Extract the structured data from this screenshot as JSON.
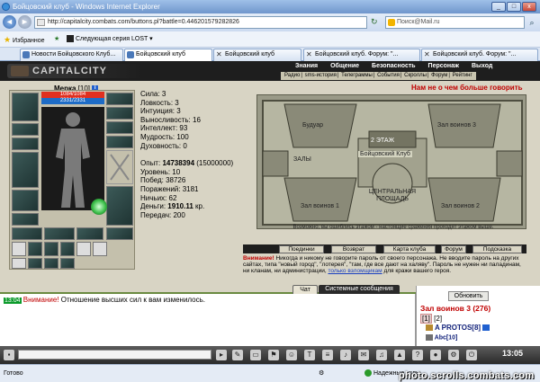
{
  "window": {
    "title": "Бойцовский клуб - Windows Internet Explorer",
    "min": "_",
    "max": "□",
    "close": "x"
  },
  "address": {
    "back": "◄",
    "forward": "►",
    "url": "http://capitalcity.combats.com/buttons.pl?battle=0.446201579282826",
    "search_placeholder": "Поиск@Mail.ru",
    "search_go": "⌕"
  },
  "favbar": {
    "favorites_label": "Избранное",
    "item": "Следующая серия LOST"
  },
  "tabs": [
    {
      "label": "Новости Бойцовского Клуб...",
      "active": false
    },
    {
      "label": "Бойцовский клуб",
      "active": true
    },
    {
      "label": "Бойцовский клуб",
      "active": false
    },
    {
      "label": "Бойцовский клуб. Форум: \"...",
      "active": false
    },
    {
      "label": "Бойцовский клуб. Форум: \"...",
      "active": false
    }
  ],
  "game": {
    "logo": "CAPITALCITY",
    "menu": [
      "Знания",
      "Общение",
      "Безопасность",
      "Персонаж",
      "Выход"
    ],
    "submenu": [
      "Радио",
      "sms-история",
      "Телеграммы",
      "События",
      "Скроллы",
      "Форум",
      "Рейтинг"
    ]
  },
  "character": {
    "name": "Мерка",
    "level": "[10]",
    "hp": "1084/1084",
    "mana": "2331/2331"
  },
  "stats": [
    {
      "label": "Сила:",
      "value": "3"
    },
    {
      "label": "Ловкость:",
      "value": "3"
    },
    {
      "label": "Интуиция:",
      "value": "3"
    },
    {
      "label": "Выносливость:",
      "value": "16"
    },
    {
      "label": "Интеллект:",
      "value": "93"
    },
    {
      "label": "Мудрость:",
      "value": "100"
    },
    {
      "label": "Духовность:",
      "value": "0"
    }
  ],
  "stats2": {
    "exp_label": "Опыт:",
    "exp_value": "14738394",
    "exp_next": "(15000000)",
    "level_line": "Уровень: 10",
    "wins_line": "Побед: 38726",
    "losses_line": "Поражений: 3181",
    "draws_line": "Ничьих: 62",
    "money_label": "Деньги:",
    "money_value": "1910.11",
    "money_unit": "кр.",
    "transfers_line": "Передач: 200"
  },
  "topic": "Нам не о чем больше говорить",
  "map": {
    "labels": [
      "Будуар",
      "Зал воинов 3",
      "2 ЭТАЖ",
      "Бойцовский Клуб",
      "ЗАЛЫ",
      "Зал воинов 1",
      "ЦЕНТРАЛЬНАЯ ПЛОЩАДЬ",
      "Зал воинов 2"
    ],
    "caption": "Возможно, вы ошиблись этажом - настоящие сражения проходят этажом выше."
  },
  "actions": [
    "Поединки",
    "Возврат",
    "Карта клуба",
    "Форум",
    "Подсказка"
  ],
  "warning": {
    "label": "Внимание!",
    "text": "Никогда и никому не говорите пароль от своего персонажа. Не вводите пароль на других сайтах, типа \"новый город\", \"лотерея\", \"там, где все дают на халяву\". Пароль не нужен ни паладинам, ни кланам, ни администрации,",
    "link": "только взломщикам",
    "tail": "для кражи вашего героя."
  },
  "chat": {
    "tabs": [
      "Чат",
      "Системные сообщения"
    ],
    "time": "13:04",
    "warn": "Внимание!",
    "message": "Отношение высших сил к вам изменилось."
  },
  "room": {
    "refresh": "Обновить",
    "name": "Зал воинов 3 (276)",
    "page1": "[1]",
    "page2": "[2]",
    "user1": "A PROTOS[8]",
    "user2": "Abc[10]"
  },
  "gamebar": {
    "clock": "13:05"
  },
  "status": {
    "ready": "Готово",
    "zone": "Надежные узлы"
  },
  "watermark": "photo.scrolls.combats.com",
  "colors": {
    "accent_red": "#c00000",
    "hp": "#e03020",
    "mana": "#1e6cc6",
    "chat_time": "#0a9a2a"
  }
}
